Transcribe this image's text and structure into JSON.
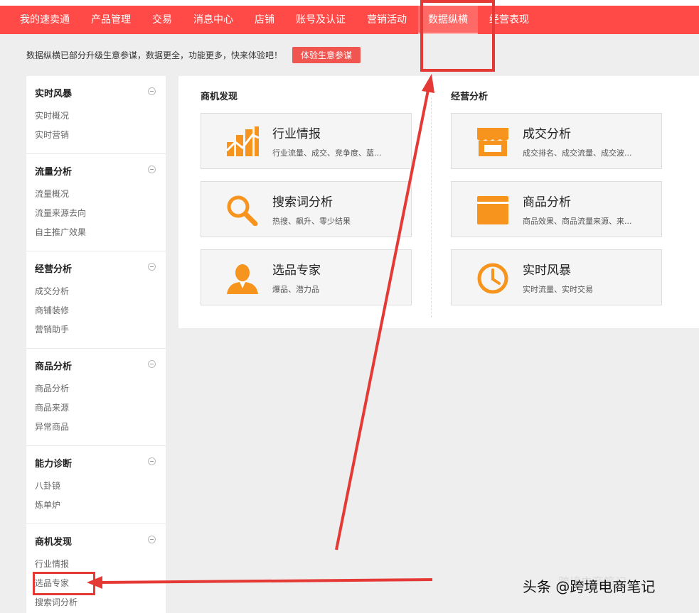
{
  "nav": {
    "items": [
      {
        "label": "我的速卖通",
        "active": false
      },
      {
        "label": "产品管理",
        "active": false
      },
      {
        "label": "交易",
        "active": false
      },
      {
        "label": "消息中心",
        "active": false
      },
      {
        "label": "店铺",
        "active": false
      },
      {
        "label": "账号及认证",
        "active": false
      },
      {
        "label": "营销活动",
        "active": false
      },
      {
        "label": "数据纵横",
        "active": true
      },
      {
        "label": "经营表现",
        "active": false
      }
    ]
  },
  "promo": {
    "text": "数据纵横已部分升级生意参谋，数据更全，功能更多，快来体验吧！",
    "button": "体验生意参谋"
  },
  "sidebar": {
    "groups": [
      {
        "title": "实时风暴",
        "items": [
          "实时概况",
          "实时营销"
        ]
      },
      {
        "title": "流量分析",
        "items": [
          "流量概况",
          "流量来源去向",
          "自主推广效果"
        ]
      },
      {
        "title": "经营分析",
        "items": [
          "成交分析",
          "商铺装修",
          "营销助手"
        ]
      },
      {
        "title": "商品分析",
        "items": [
          "商品分析",
          "商品来源",
          "异常商品"
        ]
      },
      {
        "title": "能力诊断",
        "items": [
          "八卦镜",
          "炼单炉"
        ]
      },
      {
        "title": "商机发现",
        "items": [
          "行业情报",
          "选品专家",
          "搜索词分析"
        ]
      }
    ]
  },
  "main": {
    "left_title": "商机发现",
    "right_title": "经营分析",
    "cards": [
      {
        "icon": "bar-chart-icon",
        "title": "行业情报",
        "desc": "行业流量、成交、竞争度、蓝..."
      },
      {
        "icon": "search-icon",
        "title": "搜索词分析",
        "desc": "热搜、飙升、零少结果"
      },
      {
        "icon": "person-icon",
        "title": "选品专家",
        "desc": "爆品、潜力品"
      },
      {
        "icon": "store-icon",
        "title": "成交分析",
        "desc": "成交排名、成交流量、成交波..."
      },
      {
        "icon": "box-icon",
        "title": "商品分析",
        "desc": "商品效果、商品流量来源、来..."
      },
      {
        "icon": "clock-icon",
        "title": "实时风暴",
        "desc": "实时流量、实时交易"
      }
    ]
  },
  "watermark": "头条 @跨境电商笔记",
  "watermark_faint": "跨境电商笔记",
  "colors": {
    "nav": "#ff4a47",
    "accent": "#f7941d",
    "annotation": "#e53935"
  }
}
